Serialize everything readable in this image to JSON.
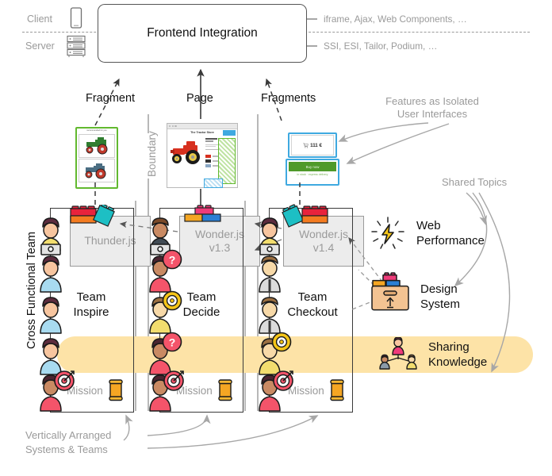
{
  "header": {
    "box_label": "Frontend Integration",
    "client_label": "Client",
    "server_label": "Server",
    "client_icon": "smartphone-icon",
    "server_icon": "server-rack-icon",
    "client_protocols": "iframe, Ajax, Web Components, …",
    "server_protocols": "SSI, ESI, Tailor, Podium, …"
  },
  "captions": {
    "fragment": "Fragment",
    "page": "Page",
    "fragments": "Fragments",
    "boundary": "Boundary",
    "cross_functional_team": "Cross Functional Team"
  },
  "annotations": {
    "features_isolated_l1": "Features as Isolated",
    "features_isolated_l2": "User Interfaces",
    "shared_topics": "Shared Topics",
    "vertically_arranged_l1": "Vertically Arranged",
    "vertically_arranged_l2": "Systems & Teams"
  },
  "mockups": {
    "fragment_left": {
      "type": "product-list-fragment",
      "header_text": "recommended for you",
      "items": [
        "green-tractor-thumb",
        "blue-tractor-thumb"
      ],
      "border_color": "#62b92f"
    },
    "page_center": {
      "type": "product-detail-page",
      "title": "The Tractor Store",
      "border_color": "#b9b9b9"
    },
    "fragment_right_top": {
      "type": "mini-cart-fragment",
      "text": "111 €",
      "icon": "shopping-cart-icon",
      "border_color": "#3fa9e0"
    },
    "fragment_right_bottom": {
      "type": "buy-button-fragment",
      "button_label": "Buy now",
      "sub_label": "in stock · express delivery",
      "button_color": "#4f9a2a",
      "border_color": "#3fa9e0"
    }
  },
  "teams": [
    {
      "name_l1": "Team",
      "name_l2": "Inspire",
      "system_name": "Thunder.js",
      "system_version": "",
      "mission_label": "Mission",
      "mission_icon": "scroll-icon",
      "bricks": [
        "red-brick",
        "orange-brick",
        "teal-brick"
      ]
    },
    {
      "name_l1": "Team",
      "name_l2": "Decide",
      "system_name": "Wonder.js",
      "system_version": "v1.3",
      "mission_label": "Mission",
      "mission_icon": "scroll-icon",
      "bricks": [
        "pink-brick",
        "orange-brick",
        "blue-brick"
      ]
    },
    {
      "name_l1": "Team",
      "name_l2": "Checkout",
      "system_name": "Wonder.js",
      "system_version": "v1.4",
      "mission_label": "Mission",
      "mission_icon": "scroll-icon",
      "bricks": [
        "teal-brick",
        "red-brick",
        "orange-brick"
      ]
    }
  ],
  "shared_topics": [
    {
      "label_l1": "Web",
      "label_l2": "Performance",
      "icon": "lightning-bolt-icon"
    },
    {
      "label_l1": "Design",
      "label_l2": "System",
      "icon": "toolbox-bricks-icon"
    },
    {
      "label_l1": "Sharing",
      "label_l2": "Knowledge",
      "icon": "people-group-icon"
    }
  ],
  "colors": {
    "band": "#fde3a7",
    "green": "#62b92f",
    "blue": "#3fa9e0",
    "gray_text": "#9a9a9a",
    "dark_text": "#1a1a1a",
    "system_fill": "#ececec"
  }
}
